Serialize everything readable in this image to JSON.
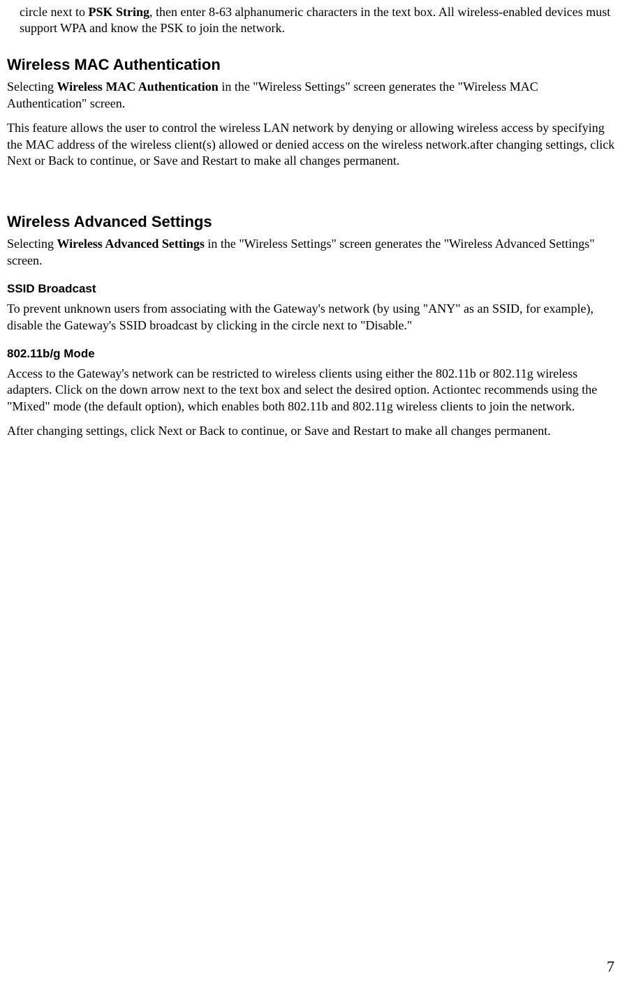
{
  "page_number": "7",
  "top_paragraph": {
    "pre": "circle next to ",
    "bold": "PSK String",
    "post": ", then enter 8-63 alphanumeric characters in the text box. All wireless-enabled devices must support WPA and know the PSK to join the network."
  },
  "section_mac": {
    "heading": "Wireless MAC Authentication",
    "p1_pre": "Selecting ",
    "p1_bold": "Wireless MAC Authentication",
    "p1_post": " in the \"Wireless Settings\" screen generates the \"Wireless MAC Authentication\" screen.",
    "p2": "This feature allows the user to control the wireless LAN network by denying or allowing wireless access by specifying the MAC address of the wireless client(s) allowed or denied access on the wireless network.after changing settings, click Next or Back to continue, or Save and Restart to make all changes permanent."
  },
  "section_adv": {
    "heading": "Wireless Advanced Settings",
    "p1_pre": "Selecting ",
    "p1_bold": "Wireless Advanced Settings",
    "p1_post": " in the \"Wireless Settings\" screen generates the \"Wireless Advanced Settings\" screen.",
    "ssid": {
      "heading": "SSID Broadcast",
      "p": "To prevent unknown users from associating with the Gateway's network (by using \"ANY\" as an SSID, for example), disable the Gateway's SSID broadcast by clicking in the circle next to \"Disable.\""
    },
    "mode": {
      "heading": "802.11b/g Mode",
      "p1": "Access to the Gateway's network can be restricted to wireless clients using either the 802.11b or 802.11g wireless adapters. Click on the down arrow next to the text box and select the desired option. Actiontec recommends using the \"Mixed\" mode (the default option), which enables both 802.11b and 802.11g wireless clients to join the network.",
      "p2": "After changing settings, click Next or Back to continue, or Save and Restart to make all changes permanent."
    }
  }
}
